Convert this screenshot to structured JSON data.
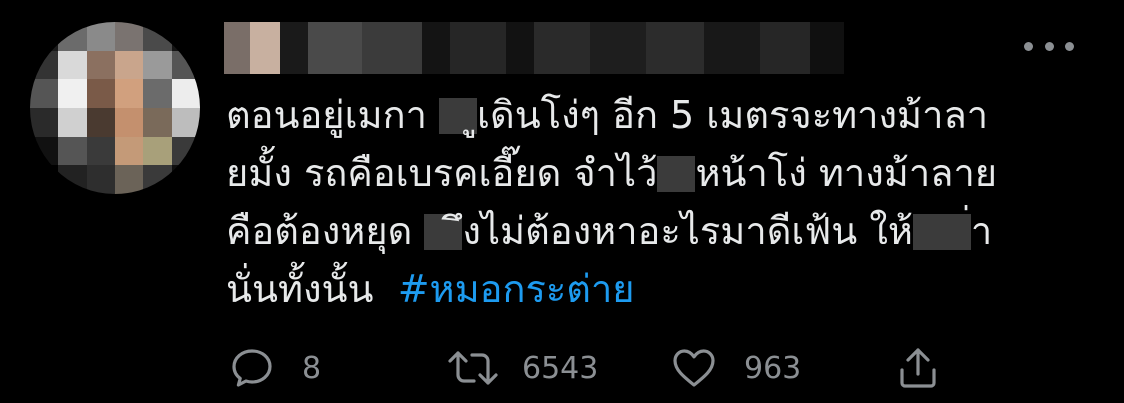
{
  "tweet": {
    "line1_a": "ตอนอยู่เมกา",
    "line1_b": "ูเดินโง่ๆ อีก 5 เมตรจะทางม้าลา",
    "line2_a": "ยมั้ง รถคือเบรคเอี๊ยด จำไว้",
    "line2_b": "หน้าโง่ ทางม้าลาย",
    "line3_a": "คือต้องหยุด",
    "line3_b": "ึงไม่ต้องหาอะไรมาดีเฟ้น ให้",
    "line3_c": "่า",
    "line4": "นั่นทั้งนั้น",
    "hashtag": "#หมอกระต่าย"
  },
  "actions": {
    "reply_count": "8",
    "retweet_count": "6543",
    "like_count": "963"
  },
  "colors": {
    "background": "#000000",
    "text": "#e7e9ea",
    "muted": "#8b8f93",
    "link": "#1d9bf0"
  },
  "icons": {
    "more": "more-horizontal-icon",
    "reply": "reply-bubble-icon",
    "retweet": "retweet-icon",
    "like": "heart-icon",
    "share": "share-upload-icon"
  }
}
